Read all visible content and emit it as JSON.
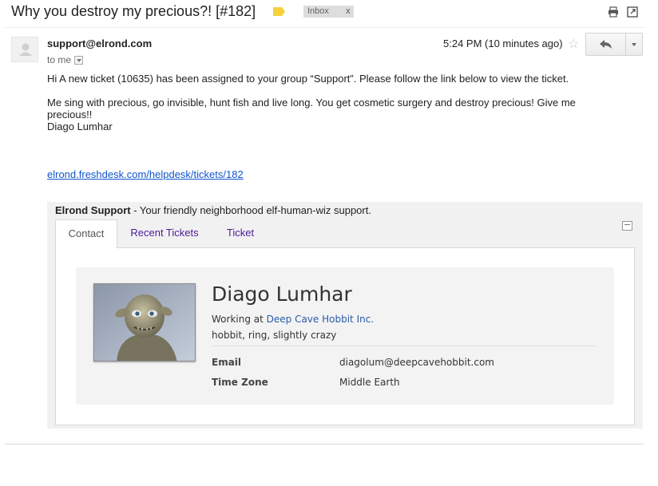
{
  "email": {
    "subject": "Why you destroy my precious?! [#182]",
    "label_chip": "Inbox",
    "label_chip_close": "x",
    "sender": "support@elrond.com",
    "recipient": "to me",
    "timestamp": "5:24 PM (10 minutes ago)",
    "body_intro": "Hi A new ticket (10635) has been assigned to your group “Support”. Please follow the link below to view the ticket.",
    "body_message": "Me sing with precious, go invisible, hunt fish and live long. You get cosmetic surgery and destroy precious! Give me precious!!",
    "body_signature": "Diago Lumhar",
    "ticket_link": "elrond.freshdesk.com/helpdesk/tickets/182"
  },
  "icons": {
    "label_tag": "label-tag-icon",
    "print": "print-icon",
    "popout": "new-window-icon",
    "star": "star-icon",
    "reply": "reply-icon",
    "more": "chevron-down-icon",
    "collapse": "collapse-icon"
  },
  "colors": {
    "label_tag": "#f5d23a",
    "link": "#1155cc",
    "tab_link": "#4b1b99",
    "company_link": "#2a5ba8"
  },
  "widget": {
    "title_bold": "Elrond Support",
    "title_rest": " - Your friendly neighborhood elf-human-wiz support.",
    "tabs": [
      "Contact",
      "Recent Tickets",
      "Ticket"
    ],
    "active_tab": "Contact",
    "contact": {
      "name": "Diago Lumhar",
      "working_prefix": "Working at ",
      "company": "Deep Cave Hobbit Inc.",
      "tags": "hobbit, ring, slightly crazy",
      "fields": [
        {
          "label": "Email",
          "value": "diagolum@deepcavehobbit.com"
        },
        {
          "label": "Time Zone",
          "value": "Middle Earth"
        }
      ]
    }
  }
}
